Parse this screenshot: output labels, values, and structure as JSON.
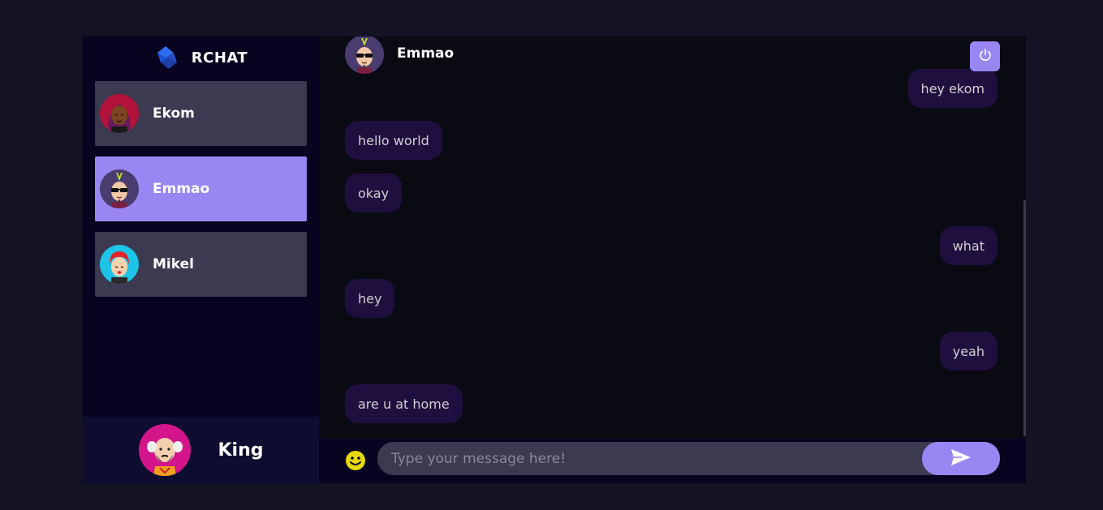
{
  "brand": {
    "name": "RCHAT",
    "logo_icon": "rchat-logo-icon"
  },
  "contacts": [
    {
      "name": "Ekom",
      "avatar_icon": "ekom-avatar-icon",
      "selected": false
    },
    {
      "name": "Emmao",
      "avatar_icon": "emmao-avatar-icon",
      "selected": true
    },
    {
      "name": "Mikel",
      "avatar_icon": "mikel-avatar-icon",
      "selected": false
    }
  ],
  "current_user": {
    "name": "King",
    "avatar_icon": "king-avatar-icon"
  },
  "chat_header": {
    "name": "Emmao",
    "avatar_icon": "emmao-avatar-icon",
    "logout_icon": "power-icon"
  },
  "messages": [
    {
      "text": "hey ekom",
      "from": "sent"
    },
    {
      "text": "hello world",
      "from": "received"
    },
    {
      "text": "okay",
      "from": "received"
    },
    {
      "text": "what",
      "from": "sent"
    },
    {
      "text": "hey",
      "from": "received"
    },
    {
      "text": "yeah",
      "from": "sent"
    },
    {
      "text": "are u at home",
      "from": "received"
    }
  ],
  "input": {
    "placeholder": "Type your message here!",
    "value": "",
    "emoji_icon": "smiley-icon",
    "send_icon": "send-icon"
  },
  "colors": {
    "accent": "#9a86f3",
    "sidebar_bg": "#080420",
    "contact_bg": "#3c3a51",
    "bubble_bg": "#1f0f3e",
    "chat_bg": "#0a0a13",
    "page_bg": "#131324"
  }
}
